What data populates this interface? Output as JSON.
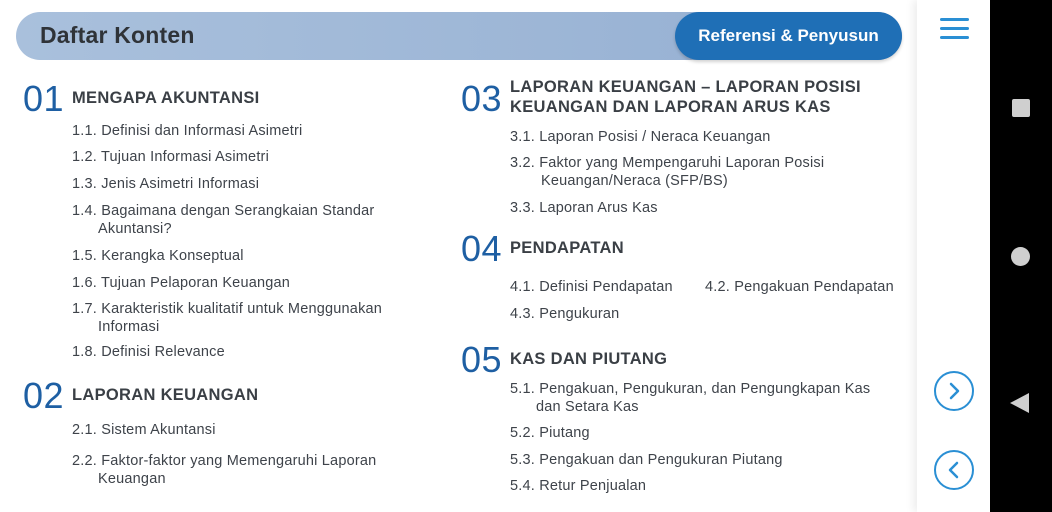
{
  "header": {
    "title": "Daftar Konten",
    "ref_button_label": "Referensi & Penyusun"
  },
  "sections": [
    {
      "number": "01",
      "title": "MENGAPA AKUNTANSI",
      "items": [
        {
          "line1": "1.1. Definisi dan Informasi Asimetri",
          "line2": ""
        },
        {
          "line1": "1.2. Tujuan Informasi Asimetri",
          "line2": ""
        },
        {
          "line1": "1.3. Jenis Asimetri Informasi",
          "line2": ""
        },
        {
          "line1": "1.4. Bagaimana dengan Serangkaian Standar",
          "line2": "Akuntansi?"
        },
        {
          "line1": "1.5. Kerangka Konseptual",
          "line2": ""
        },
        {
          "line1": "1.6. Tujuan Pelaporan Keuangan",
          "line2": ""
        },
        {
          "line1": "1.7. Karakteristik kualitatif untuk Menggunakan",
          "line2": "Informasi"
        },
        {
          "line1": "1.8. Definisi Relevance",
          "line2": ""
        }
      ]
    },
    {
      "number": "02",
      "title": "LAPORAN KEUANGAN",
      "items": [
        {
          "line1": "2.1. Sistem Akuntansi",
          "line2": ""
        },
        {
          "line1": "2.2. Faktor-faktor yang Memengaruhi Laporan",
          "line2": "Keuangan"
        }
      ]
    },
    {
      "number": "03",
      "title_line1": "LAPORAN KEUANGAN – LAPORAN POSISI",
      "title_line2": "KEUANGAN DAN LAPORAN ARUS KAS",
      "items": [
        {
          "line1": "3.1. Laporan Posisi / Neraca Keuangan",
          "line2": ""
        },
        {
          "line1": "3.2. Faktor yang Mempengaruhi Laporan Posisi",
          "line2": "Keuangan/Neraca (SFP/BS)"
        },
        {
          "line1": "3.3. Laporan Arus Kas",
          "line2": ""
        }
      ]
    },
    {
      "number": "04",
      "title": "PENDAPATAN",
      "items": [
        {
          "line1": "4.1. Definisi Pendapatan",
          "line2": ""
        },
        {
          "line1": "4.2. Pengakuan Pendapatan",
          "line2": ""
        },
        {
          "line1": "4.3. Pengukuran",
          "line2": ""
        }
      ]
    },
    {
      "number": "05",
      "title": "KAS DAN PIUTANG",
      "items": [
        {
          "line1": "5.1. Pengakuan, Pengukuran, dan Pengungkapan Kas",
          "line2": "dan Setara Kas"
        },
        {
          "line1": "5.2. Piutang",
          "line2": ""
        },
        {
          "line1": "5.3. Pengakuan dan Pengukuran Piutang",
          "line2": ""
        },
        {
          "line1": "5.4. Retur Penjualan",
          "line2": ""
        }
      ]
    }
  ],
  "icons": {
    "menu": "hamburger-menu-icon",
    "next": "chevron-right-circle-icon",
    "prev": "chevron-left-circle-icon",
    "android_recents": "square-icon",
    "android_home": "circle-icon",
    "android_back": "triangle-back-icon"
  },
  "colors": {
    "accent_blue": "#1f6fb6",
    "header_bar": "#a9c0dc",
    "section_number": "#1e5fa3",
    "icon_blue": "#2a8fd4"
  }
}
